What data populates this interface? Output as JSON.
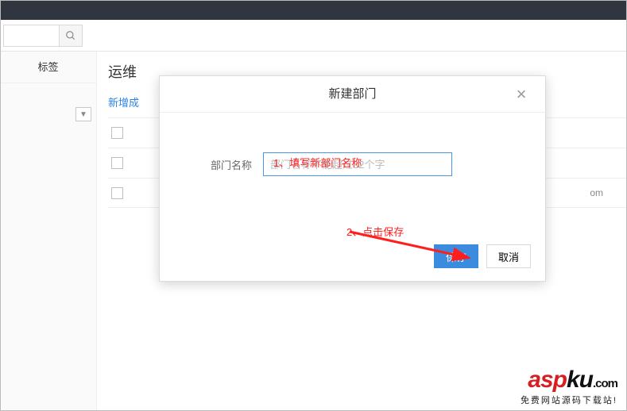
{
  "sidebar": {
    "tab_label": "标签"
  },
  "search": {
    "value": "",
    "placeholder": ""
  },
  "main": {
    "title": "运维",
    "add_link": "新增成",
    "row_tail": "om"
  },
  "modal": {
    "title": "新建部门",
    "field_label": "部门名称",
    "placeholder": "部门名称不能超过32个字",
    "save": "保存",
    "cancel": "取消"
  },
  "annotation": {
    "step1": "1、填写新部门名称",
    "step2": "2、点击保存"
  },
  "watermark": {
    "brand_red": "asp",
    "brand_black": "ku",
    "brand_tld": ".com",
    "sub": "免费网站源码下载站!"
  }
}
